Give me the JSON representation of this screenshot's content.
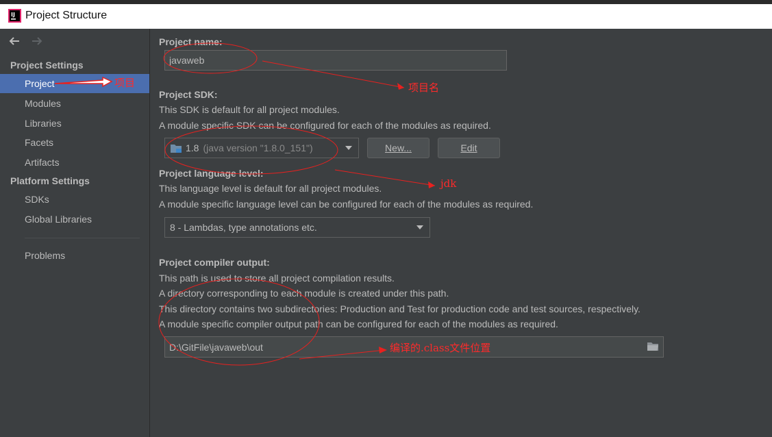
{
  "window": {
    "title": "Project Structure"
  },
  "sidebar": {
    "project_settings_header": "Project Settings",
    "project_settings_items": [
      {
        "label": "Project",
        "selected": true
      },
      {
        "label": "Modules"
      },
      {
        "label": "Libraries"
      },
      {
        "label": "Facets"
      },
      {
        "label": "Artifacts"
      }
    ],
    "platform_settings_header": "Platform Settings",
    "platform_settings_items": [
      {
        "label": "SDKs"
      },
      {
        "label": "Global Libraries"
      }
    ],
    "problems_label": "Problems"
  },
  "project_name": {
    "label": "Project name:",
    "value": "javaweb"
  },
  "project_sdk": {
    "label": "Project SDK:",
    "desc1": "This SDK is default for all project modules.",
    "desc2": "A module specific SDK can be configured for each of the modules as required.",
    "selected_name": "1.8",
    "selected_version": "(java version \"1.8.0_151\")",
    "new_button": "New...",
    "edit_button": "Edit"
  },
  "language_level": {
    "label": "Project language level:",
    "desc1": "This language level is default for all project modules.",
    "desc2": "A module specific language level can be configured for each of the modules as required.",
    "selected": "8 - Lambdas, type annotations etc."
  },
  "compiler_output": {
    "label": "Project compiler output:",
    "desc1": "This path is used to store all project compilation results.",
    "desc2": "A directory corresponding to each module is created under this path.",
    "desc3": "This directory contains two subdirectories: Production and Test for production code and test sources, respectively.",
    "desc4": "A module specific compiler output path can be configured for each of the modules as required.",
    "path": "D:\\GitFile\\javaweb\\out"
  },
  "annotations": {
    "project": "项目",
    "project_name": "项目名",
    "jdk": "jdk",
    "class_output": "编译的.class文件位置"
  },
  "colors": {
    "background": "#3c3f41",
    "selection": "#4b6eaf",
    "annotation": "#ff2a2a"
  }
}
